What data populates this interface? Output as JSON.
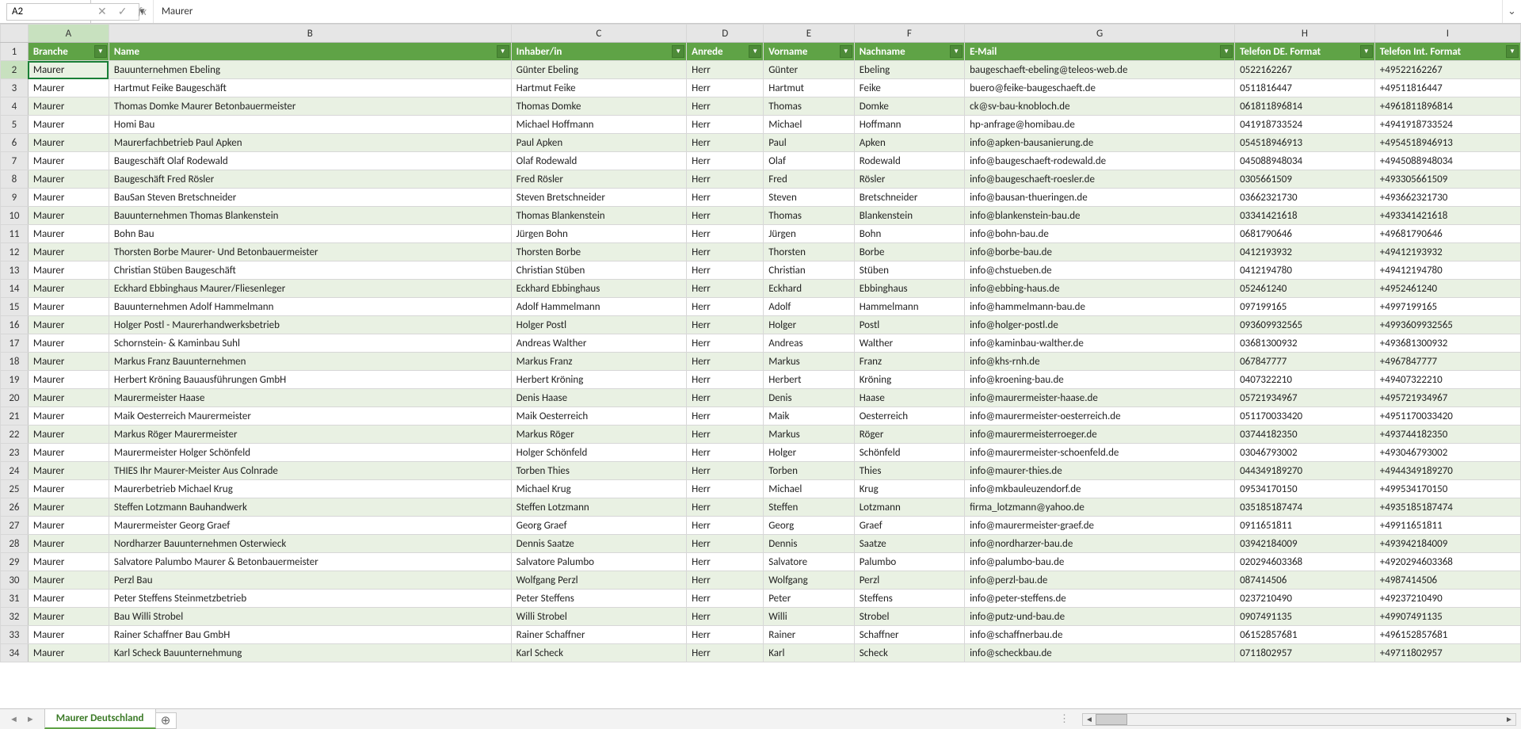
{
  "formula_bar": {
    "namebox_value": "A2",
    "formula_value": "Maurer"
  },
  "columns": [
    "A",
    "B",
    "C",
    "D",
    "E",
    "F",
    "G",
    "H",
    "I"
  ],
  "selected_cell_col": "A",
  "headers": {
    "A": "Branche",
    "B": "Name",
    "C": "Inhaber/in",
    "D": "Anrede",
    "E": "Vorname",
    "F": "Nachname",
    "G": "E-Mail",
    "H": "Telefon DE. Format",
    "I": "Telefon Int. Format"
  },
  "rows": [
    {
      "n": 2,
      "A": "Maurer",
      "B": "Bauunternehmen Ebeling",
      "C": "Günter Ebeling",
      "D": "Herr",
      "E": "Günter",
      "F": "Ebeling",
      "G": "baugeschaeft-ebeling@teleos-web.de",
      "H": "0522162267",
      "I": "+49522162267"
    },
    {
      "n": 3,
      "A": "Maurer",
      "B": "Hartmut Feike Baugeschäft",
      "C": "Hartmut Feike",
      "D": "Herr",
      "E": "Hartmut",
      "F": "Feike",
      "G": "buero@feike-baugeschaeft.de",
      "H": "0511816447",
      "I": "+49511816447"
    },
    {
      "n": 4,
      "A": "Maurer",
      "B": "Thomas Domke Maurer Betonbauermeister",
      "C": "Thomas Domke",
      "D": "Herr",
      "E": "Thomas",
      "F": "Domke",
      "G": "ck@sv-bau-knobloch.de",
      "H": "061811896814",
      "I": "+4961811896814"
    },
    {
      "n": 5,
      "A": "Maurer",
      "B": "Homi Bau",
      "C": "Michael Hoffmann",
      "D": "Herr",
      "E": "Michael",
      "F": "Hoffmann",
      "G": "hp-anfrage@homibau.de",
      "H": "041918733524",
      "I": "+4941918733524"
    },
    {
      "n": 6,
      "A": "Maurer",
      "B": "Maurerfachbetrieb Paul Apken",
      "C": "Paul Apken",
      "D": "Herr",
      "E": "Paul",
      "F": "Apken",
      "G": "info@apken-bausanierung.de",
      "H": "054518946913",
      "I": "+4954518946913"
    },
    {
      "n": 7,
      "A": "Maurer",
      "B": "Baugeschäft Olaf Rodewald",
      "C": "Olaf Rodewald",
      "D": "Herr",
      "E": "Olaf",
      "F": "Rodewald",
      "G": "info@baugeschaeft-rodewald.de",
      "H": "045088948034",
      "I": "+4945088948034"
    },
    {
      "n": 8,
      "A": "Maurer",
      "B": "Baugeschäft Fred Rösler",
      "C": "Fred Rösler",
      "D": "Herr",
      "E": "Fred",
      "F": "Rösler",
      "G": "info@baugeschaeft-roesler.de",
      "H": "0305661509",
      "I": "+493305661509"
    },
    {
      "n": 9,
      "A": "Maurer",
      "B": "BauSan Steven Bretschneider",
      "C": "Steven Bretschneider",
      "D": "Herr",
      "E": "Steven",
      "F": "Bretschneider",
      "G": "info@bausan-thueringen.de",
      "H": "03662321730",
      "I": "+493662321730"
    },
    {
      "n": 10,
      "A": "Maurer",
      "B": "Bauunternehmen Thomas Blankenstein",
      "C": "Thomas Blankenstein",
      "D": "Herr",
      "E": "Thomas",
      "F": "Blankenstein",
      "G": "info@blankenstein-bau.de",
      "H": "03341421618",
      "I": "+493341421618"
    },
    {
      "n": 11,
      "A": "Maurer",
      "B": "Bohn Bau",
      "C": "Jürgen Bohn",
      "D": "Herr",
      "E": "Jürgen",
      "F": "Bohn",
      "G": "info@bohn-bau.de",
      "H": "0681790646",
      "I": "+49681790646"
    },
    {
      "n": 12,
      "A": "Maurer",
      "B": "Thorsten Borbe Maurer- Und Betonbauermeister",
      "C": "Thorsten Borbe",
      "D": "Herr",
      "E": "Thorsten",
      "F": "Borbe",
      "G": "info@borbe-bau.de",
      "H": "0412193932",
      "I": "+49412193932"
    },
    {
      "n": 13,
      "A": "Maurer",
      "B": "Christian Stüben Baugeschäft",
      "C": "Christian Stüben",
      "D": "Herr",
      "E": "Christian",
      "F": "Stüben",
      "G": "info@chstueben.de",
      "H": "0412194780",
      "I": "+49412194780"
    },
    {
      "n": 14,
      "A": "Maurer",
      "B": "Eckhard Ebbinghaus Maurer/Fliesenleger",
      "C": "Eckhard Ebbinghaus",
      "D": "Herr",
      "E": "Eckhard",
      "F": "Ebbinghaus",
      "G": "info@ebbing-haus.de",
      "H": "052461240",
      "I": "+4952461240"
    },
    {
      "n": 15,
      "A": "Maurer",
      "B": "Bauunternehmen Adolf Hammelmann",
      "C": "Adolf Hammelmann",
      "D": "Herr",
      "E": "Adolf",
      "F": "Hammelmann",
      "G": "info@hammelmann-bau.de",
      "H": "097199165",
      "I": "+4997199165"
    },
    {
      "n": 16,
      "A": "Maurer",
      "B": "Holger Postl - Maurerhandwerksbetrieb",
      "C": "Holger Postl",
      "D": "Herr",
      "E": "Holger",
      "F": "Postl",
      "G": "info@holger-postl.de",
      "H": "093609932565",
      "I": "+4993609932565"
    },
    {
      "n": 17,
      "A": "Maurer",
      "B": "Schornstein- & Kaminbau Suhl",
      "C": "Andreas Walther",
      "D": "Herr",
      "E": "Andreas",
      "F": "Walther",
      "G": "info@kaminbau-walther.de",
      "H": "03681300932",
      "I": "+493681300932"
    },
    {
      "n": 18,
      "A": "Maurer",
      "B": "Markus Franz Bauunternehmen",
      "C": "Markus Franz",
      "D": "Herr",
      "E": "Markus",
      "F": "Franz",
      "G": "info@khs-rnh.de",
      "H": "067847777",
      "I": "+4967847777"
    },
    {
      "n": 19,
      "A": "Maurer",
      "B": "Herbert Kröning Bauausführungen GmbH",
      "C": "Herbert Kröning",
      "D": "Herr",
      "E": "Herbert",
      "F": "Kröning",
      "G": "info@kroening-bau.de",
      "H": "0407322210",
      "I": "+49407322210"
    },
    {
      "n": 20,
      "A": "Maurer",
      "B": "Maurermeister Haase",
      "C": "Denis Haase",
      "D": "Herr",
      "E": "Denis",
      "F": "Haase",
      "G": "info@maurermeister-haase.de",
      "H": "05721934967",
      "I": "+495721934967"
    },
    {
      "n": 21,
      "A": "Maurer",
      "B": "Maik Oesterreich Maurermeister",
      "C": "Maik Oesterreich",
      "D": "Herr",
      "E": "Maik",
      "F": "Oesterreich",
      "G": "info@maurermeister-oesterreich.de",
      "H": "051170033420",
      "I": "+4951170033420"
    },
    {
      "n": 22,
      "A": "Maurer",
      "B": "Markus Röger Maurermeister",
      "C": "Markus Röger",
      "D": "Herr",
      "E": "Markus",
      "F": "Röger",
      "G": "info@maurermeisterroeger.de",
      "H": "03744182350",
      "I": "+493744182350"
    },
    {
      "n": 23,
      "A": "Maurer",
      "B": "Maurermeister Holger Schönfeld",
      "C": "Holger Schönfeld",
      "D": "Herr",
      "E": "Holger",
      "F": "Schönfeld",
      "G": "info@maurermeister-schoenfeld.de",
      "H": "03046793002",
      "I": "+493046793002"
    },
    {
      "n": 24,
      "A": "Maurer",
      "B": "THIES Ihr Maurer-Meister Aus Colnrade",
      "C": "Torben Thies",
      "D": "Herr",
      "E": "Torben",
      "F": "Thies",
      "G": "info@maurer-thies.de",
      "H": "044349189270",
      "I": "+4944349189270"
    },
    {
      "n": 25,
      "A": "Maurer",
      "B": "Maurerbetrieb Michael Krug",
      "C": "Michael Krug",
      "D": "Herr",
      "E": "Michael",
      "F": "Krug",
      "G": "info@mkbauleuzendorf.de",
      "H": "09534170150",
      "I": "+499534170150"
    },
    {
      "n": 26,
      "A": "Maurer",
      "B": "Steffen Lotzmann Bauhandwerk",
      "C": "Steffen Lotzmann",
      "D": "Herr",
      "E": "Steffen",
      "F": "Lotzmann",
      "G": "firma_lotzmann@yahoo.de",
      "H": "035185187474",
      "I": "+4935185187474"
    },
    {
      "n": 27,
      "A": "Maurer",
      "B": "Maurermeister Georg Graef",
      "C": "Georg Graef",
      "D": "Herr",
      "E": "Georg",
      "F": "Graef",
      "G": "info@maurermeister-graef.de",
      "H": "0911651811",
      "I": "+49911651811"
    },
    {
      "n": 28,
      "A": "Maurer",
      "B": "Nordharzer Bauunternehmen Osterwieck",
      "C": "Dennis Saatze",
      "D": "Herr",
      "E": "Dennis",
      "F": "Saatze",
      "G": "info@nordharzer-bau.de",
      "H": "03942184009",
      "I": "+493942184009"
    },
    {
      "n": 29,
      "A": "Maurer",
      "B": "Salvatore Palumbo Maurer & Betonbauermeister",
      "C": "Salvatore Palumbo",
      "D": "Herr",
      "E": "Salvatore",
      "F": "Palumbo",
      "G": "info@palumbo-bau.de",
      "H": "020294603368",
      "I": "+4920294603368"
    },
    {
      "n": 30,
      "A": "Maurer",
      "B": "Perzl Bau",
      "C": "Wolfgang Perzl",
      "D": "Herr",
      "E": "Wolfgang",
      "F": "Perzl",
      "G": "info@perzl-bau.de",
      "H": "087414506",
      "I": "+4987414506"
    },
    {
      "n": 31,
      "A": "Maurer",
      "B": "Peter Steffens Steinmetzbetrieb",
      "C": "Peter Steffens",
      "D": "Herr",
      "E": "Peter",
      "F": "Steffens",
      "G": "info@peter-steffens.de",
      "H": "0237210490",
      "I": "+49237210490"
    },
    {
      "n": 32,
      "A": "Maurer",
      "B": "Bau Willi Strobel",
      "C": "Willi Strobel",
      "D": "Herr",
      "E": "Willi",
      "F": "Strobel",
      "G": "info@putz-und-bau.de",
      "H": "0907491135",
      "I": "+49907491135"
    },
    {
      "n": 33,
      "A": "Maurer",
      "B": "Rainer Schaffner Bau GmbH",
      "C": "Rainer Schaffner",
      "D": "Herr",
      "E": "Rainer",
      "F": "Schaffner",
      "G": "info@schaffnerbau.de",
      "H": "06152857681",
      "I": "+496152857681"
    },
    {
      "n": 34,
      "A": "Maurer",
      "B": "Karl Scheck Bauunternehmung",
      "C": "Karl Scheck",
      "D": "Herr",
      "E": "Karl",
      "F": "Scheck",
      "G": "info@scheckbau.de",
      "H": "0711802957",
      "I": "+49711802957"
    }
  ],
  "sheet_tab": "Maurer Deutschland"
}
